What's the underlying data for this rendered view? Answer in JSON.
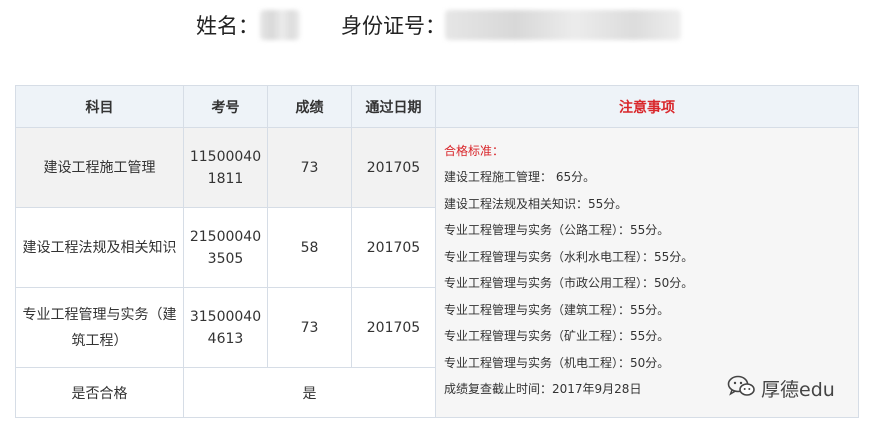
{
  "header": {
    "name_label": "姓名：",
    "id_label": "身份证号："
  },
  "table": {
    "columns": [
      "科目",
      "考号",
      "成绩",
      "通过日期",
      "注意事项"
    ],
    "rows": [
      {
        "subject": "建设工程施工管理",
        "exam_no_line1": "11500040",
        "exam_no_line2": "1811",
        "score": "73",
        "pass_date": "201705"
      },
      {
        "subject": "建设工程法规及相关知识",
        "exam_no_line1": "21500040",
        "exam_no_line2": "3505",
        "score": "58",
        "pass_date": "201705"
      },
      {
        "subject": "专业工程管理与实务（建筑工程）",
        "exam_no_line1": "31500040",
        "exam_no_line2": "4613",
        "score": "73",
        "pass_date": "201705"
      }
    ],
    "pass_row": {
      "label": "是否合格",
      "value": "是"
    },
    "notes": {
      "title": "合格标准：",
      "lines": [
        "建设工程施工管理： 65分。",
        "建设工程法规及相关知识：55分。",
        "专业工程管理与实务（公路工程）：55分。",
        "专业工程管理与实务（水利水电工程）：55分。",
        "专业工程管理与实务（市政公用工程）：50分。",
        "专业工程管理与实务（建筑工程）：55分。",
        "专业工程管理与实务（矿业工程）：55分。",
        "专业工程管理与实务（机电工程）：50分。",
        "成绩复查截止时间：2017年9月28日"
      ]
    }
  },
  "watermark": {
    "icon": "wechat-icon",
    "text": "厚德edu"
  },
  "colors": {
    "accent_red": "#d9262b",
    "header_bg": "#eef3f8",
    "border": "#d6dde6"
  }
}
